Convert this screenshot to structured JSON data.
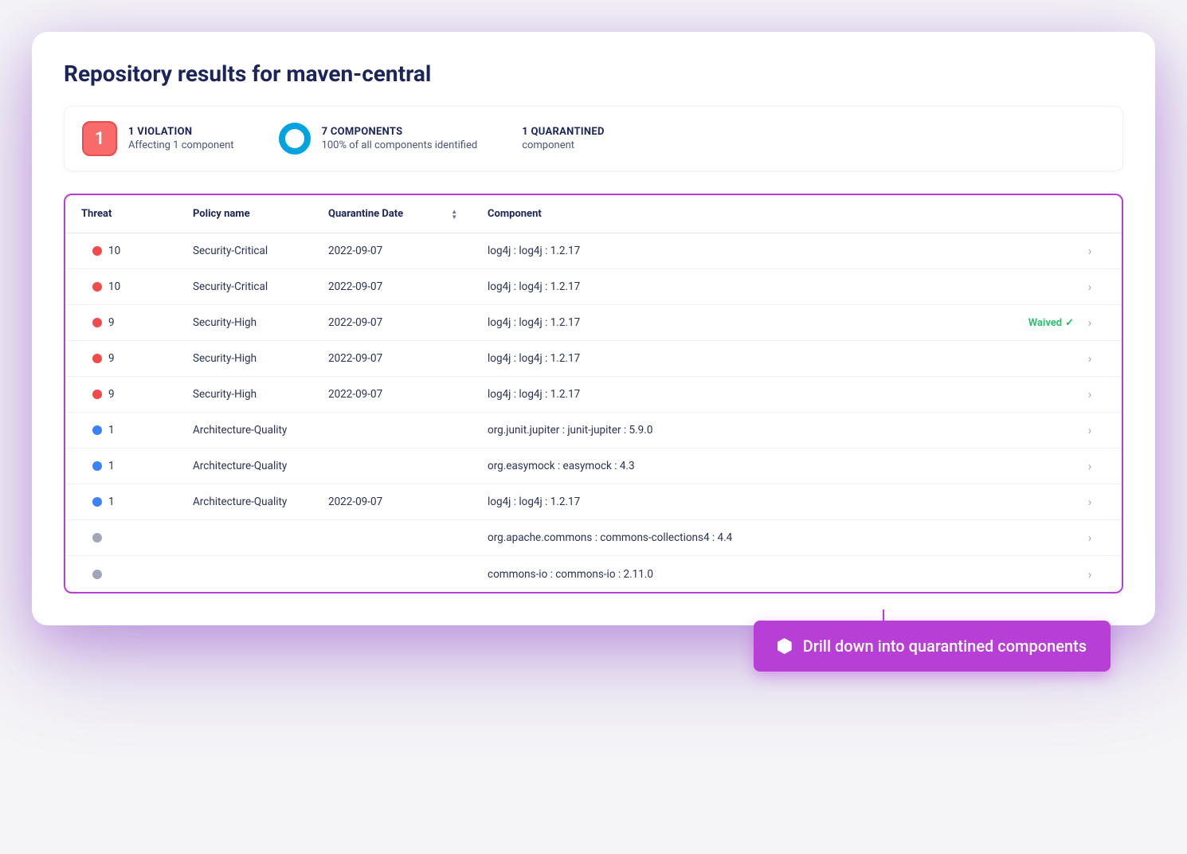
{
  "title": "Repository results for maven-central",
  "summary": {
    "violations": {
      "count": "1",
      "heading": "1 VIOLATION",
      "sub": "Affecting 1 component"
    },
    "components": {
      "heading": "7 COMPONENTS",
      "sub": "100% of all components identified"
    },
    "quarantined": {
      "heading": "1 QUARANTINED",
      "sub": "component"
    }
  },
  "columns": {
    "threat": "Threat",
    "policy": "Policy name",
    "date": "Quarantine Date",
    "component": "Component"
  },
  "waived_label": "Waived",
  "callout": "Drill down into quarantined components",
  "rows": [
    {
      "threat": "10",
      "dot": "red",
      "policy": "Security-Critical",
      "date": "2022-09-07",
      "component": "log4j : log4j : 1.2.17",
      "waived": false
    },
    {
      "threat": "10",
      "dot": "red",
      "policy": "Security-Critical",
      "date": "2022-09-07",
      "component": "log4j : log4j : 1.2.17",
      "waived": false
    },
    {
      "threat": "9",
      "dot": "red",
      "policy": "Security-High",
      "date": "2022-09-07",
      "component": "log4j : log4j : 1.2.17",
      "waived": true
    },
    {
      "threat": "9",
      "dot": "red",
      "policy": "Security-High",
      "date": "2022-09-07",
      "component": "log4j : log4j : 1.2.17",
      "waived": false
    },
    {
      "threat": "9",
      "dot": "red",
      "policy": "Security-High",
      "date": "2022-09-07",
      "component": "log4j : log4j : 1.2.17",
      "waived": false
    },
    {
      "threat": "1",
      "dot": "blue",
      "policy": "Architecture-Quality",
      "date": "",
      "component": "org.junit.jupiter : junit-jupiter : 5.9.0",
      "waived": false
    },
    {
      "threat": "1",
      "dot": "blue",
      "policy": "Architecture-Quality",
      "date": "",
      "component": "org.easymock : easymock : 4.3",
      "waived": false
    },
    {
      "threat": "1",
      "dot": "blue",
      "policy": "Architecture-Quality",
      "date": "2022-09-07",
      "component": "log4j : log4j : 1.2.17",
      "waived": false
    },
    {
      "threat": "",
      "dot": "gray",
      "policy": "",
      "date": "",
      "component": "org.apache.commons : commons-collections4 : 4.4",
      "waived": false
    },
    {
      "threat": "",
      "dot": "gray",
      "policy": "",
      "date": "",
      "component": "commons-io : commons-io : 2.11.0",
      "waived": false
    }
  ]
}
